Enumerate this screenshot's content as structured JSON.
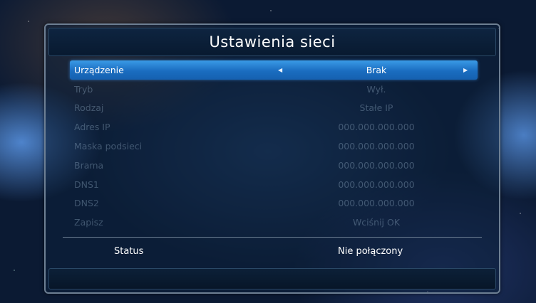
{
  "title": "Ustawienia sieci",
  "rows": [
    {
      "label": "Urządzenie",
      "value": "Brak",
      "selected": true
    },
    {
      "label": "Tryb",
      "value": "Wył."
    },
    {
      "label": "Rodzaj",
      "value": "Stałe IP"
    },
    {
      "label": "Adres IP",
      "value": "000.000.000.000"
    },
    {
      "label": "Maska podsieci",
      "value": "000.000.000.000"
    },
    {
      "label": "Brama",
      "value": "000.000.000.000"
    },
    {
      "label": "DNS1",
      "value": "000.000.000.000"
    },
    {
      "label": "DNS2",
      "value": "000.000.000.000"
    },
    {
      "label": "Zapisz",
      "value": "Wciśnij OK"
    }
  ],
  "status": {
    "label": "Status",
    "value": "Nie połączony"
  },
  "icons": {
    "left": "arrow-left-icon",
    "right": "arrow-right-icon"
  },
  "colors": {
    "highlight": "#1a6dc0",
    "panel_border": "#6d7f93"
  }
}
